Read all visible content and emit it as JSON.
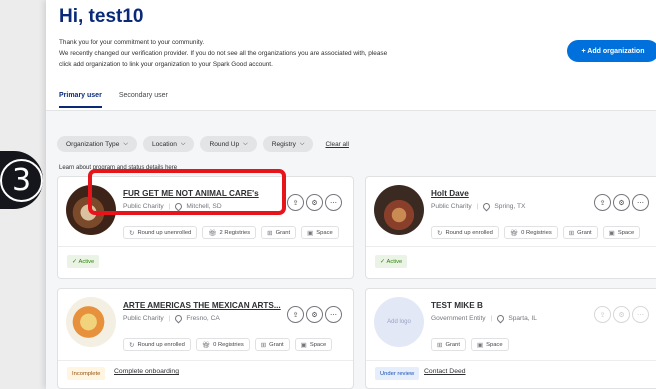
{
  "header": {
    "greeting": "Hi, test10",
    "intro_lines": [
      "Thank you for your commitment to your community.",
      "We recently changed our verification provider. If you do not see all the organizations you are associated with, please",
      "click add organization to link your organization to your Spark Good account."
    ],
    "add_org_label": "+ Add organization"
  },
  "tabs": [
    {
      "label": "Primary user",
      "active": true
    },
    {
      "label": "Secondary user",
      "active": false
    }
  ],
  "filters": [
    "Organization Type",
    "Location",
    "Round Up",
    "Registry"
  ],
  "clear_all": "Clear all",
  "learn_text": "Learn about program and status details  here",
  "step_number": "3",
  "colors": {
    "brand_blue": "#0071dc",
    "title_navy": "#0a2a78",
    "highlight_red": "#e8141c"
  },
  "cards": [
    {
      "name": "FUR GET ME NOT ANIMAL CARE's",
      "type": "Public Charity",
      "location": "Mitchell, SD",
      "chips": [
        "Round up unenrolled",
        "2 Registries",
        "Grant",
        "Space"
      ],
      "status": "Active",
      "status_link": ""
    },
    {
      "name": "Holt Dave",
      "type": "Public Charity",
      "location": "Spring, TX",
      "chips": [
        "Round up enrolled",
        "0 Registries",
        "Grant",
        "Space"
      ],
      "status": "Active",
      "status_link": ""
    },
    {
      "name": "ARTE AMERICAS THE MEXICAN ARTS...",
      "type": "Public Charity",
      "location": "Fresno, CA",
      "chips": [
        "Round up enrolled",
        "0 Registries",
        "Grant",
        "Space"
      ],
      "status": "Incomplete",
      "status_link": "Complete onboarding"
    },
    {
      "name": "TEST MIKE B",
      "type": "Government Entity",
      "location": "Sparta, IL",
      "chips": [
        "Grant",
        "Space"
      ],
      "logo_text": "Add logo",
      "status": "Under review",
      "status_link": "Contact Deed"
    }
  ]
}
